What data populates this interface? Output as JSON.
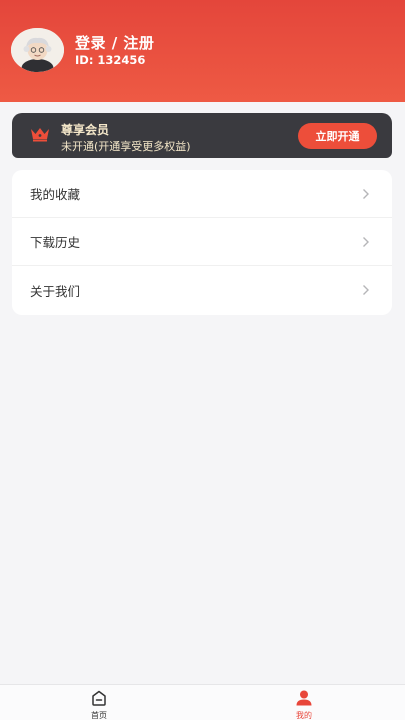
{
  "header": {
    "login_title": "登录 / 注册",
    "user_id": "ID: 132456"
  },
  "vip": {
    "title": "尊享会员",
    "subtitle": "未开通(开通享受更多权益)",
    "button_label": "立即开通",
    "icon": "crown-icon"
  },
  "menu": {
    "items": [
      {
        "label": "我的收藏"
      },
      {
        "label": "下载历史"
      },
      {
        "label": "关于我们"
      }
    ]
  },
  "tabbar": {
    "home_label": "首页",
    "mine_label": "我的",
    "active": "mine"
  },
  "colors": {
    "brand": "#e8463a",
    "vip_bg": "#3a3a3f",
    "vip_text": "#f4e7c9"
  }
}
